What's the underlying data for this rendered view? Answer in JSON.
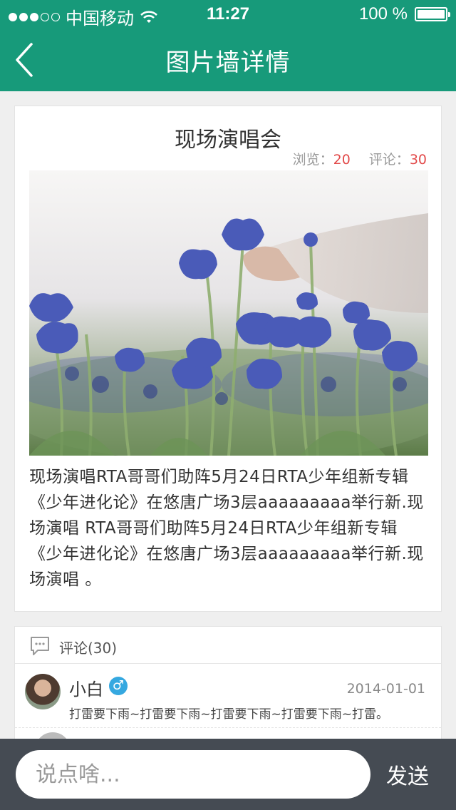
{
  "status_bar": {
    "carrier": "中国移动",
    "time": "11:27",
    "battery": "100 %",
    "signal_bars_filled": 3,
    "signal_bars_total": 5
  },
  "nav": {
    "title": "图片墙详情",
    "back_icon": "chevron-left-icon"
  },
  "post": {
    "title": "现场演唱会",
    "views_label": "浏览：",
    "views": "20",
    "comments_label": "评论：",
    "comments": "30",
    "image_subject": "blue-flowers-photo",
    "description": "现场演唱RTA哥哥们助阵5月24日RTA少年组新专辑《少年进化论》在悠唐广场3层aaaaaaaaa举行新.现场演唱  RTA哥哥们助阵5月24日RTA少年组新专辑《少年进化论》在悠唐广场3层aaaaaaaaa举行新.现场演唱 。"
  },
  "comments_section": {
    "header_label": "评论(30)",
    "header_icon": "comment-bubble-icon",
    "items": [
      {
        "name": "小白",
        "gender": "male",
        "gender_symbol": "♂",
        "date": "2014-01-01",
        "text": "打雷要下雨~打雷要下雨~打雷要下雨~打雷要下雨~打雷。"
      }
    ]
  },
  "input_bar": {
    "placeholder": "说点啥...",
    "send_label": "发送"
  },
  "colors": {
    "header": "#179a7a",
    "accent_red": "#e24a4a",
    "bottom_bar": "#454b53",
    "gender_male": "#35a8e0"
  }
}
